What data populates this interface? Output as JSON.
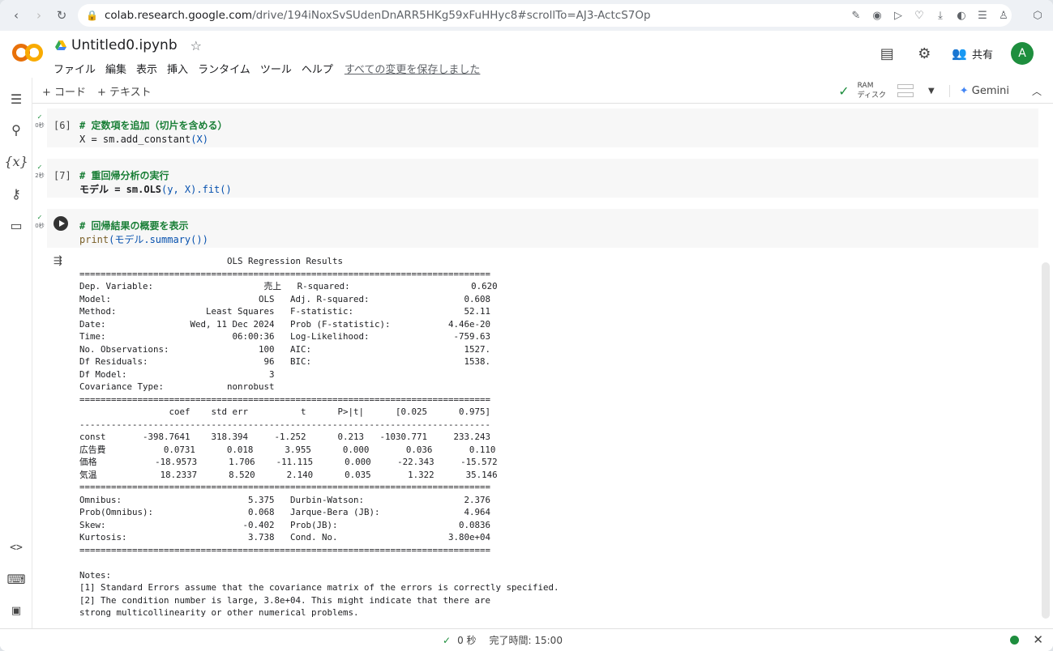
{
  "browser": {
    "url_host": "colab.research.google.com",
    "url_path": "/drive/194iNoxSvSUdenDnARR5HKg59xFuHHyc8#scrollTo=AJ3-ActcS7Op"
  },
  "header": {
    "filename": "Untitled0.ipynb",
    "menu": [
      "ファイル",
      "編集",
      "表示",
      "挿入",
      "ランタイム",
      "ツール",
      "ヘルプ"
    ],
    "saved_status": "すべての変更を保存しました",
    "share_label": "共有",
    "avatar_initial": "A"
  },
  "toolbar": {
    "add_code": "+ コード",
    "add_text": "+ テキスト",
    "ram_label": "RAM",
    "disk_label": "ディスク",
    "gemini_label": "Gemini"
  },
  "cells": [
    {
      "exec_count": "[6]",
      "status_check": "✓",
      "exec_time": "0秒",
      "comment": "# 定数項を追加（切片を含める）",
      "code_pre": "X = sm.add_constant",
      "code_args": "(X)"
    },
    {
      "exec_count": "[7]",
      "status_check": "✓",
      "exec_time": "2秒",
      "comment": "# 重回帰分析の実行",
      "code_pre": "モデル = sm.OLS",
      "code_args": "(y, X).fit()"
    },
    {
      "exec_count": "",
      "status_check": "✓",
      "exec_time": "0秒",
      "comment": "# 回帰結果の概要を表示",
      "code_pre": "print",
      "code_args": "(モデル.summary())"
    }
  ],
  "output_text": "                            OLS Regression Results                            \n==============================================================================\nDep. Variable:                     売上   R-squared:                       0.620\nModel:                            OLS   Adj. R-squared:                  0.608\nMethod:                 Least Squares   F-statistic:                     52.11\nDate:                Wed, 11 Dec 2024   Prob (F-statistic):           4.46e-20\nTime:                        06:00:36   Log-Likelihood:                -759.63\nNo. Observations:                 100   AIC:                             1527.\nDf Residuals:                      96   BIC:                             1538.\nDf Model:                           3                                         \nCovariance Type:            nonrobust                                         \n==============================================================================\n                 coef    std err          t      P>|t|      [0.025      0.975]\n------------------------------------------------------------------------------\nconst       -398.7641    318.394     -1.252      0.213   -1030.771     233.243\n広告費           0.0731      0.018      3.955      0.000       0.036       0.110\n価格           -18.9573      1.706    -11.115      0.000     -22.343     -15.572\n気温            18.2337      8.520      2.140      0.035       1.322      35.146\n==============================================================================\nOmnibus:                        5.375   Durbin-Watson:                   2.376\nProb(Omnibus):                  0.068   Jarque-Bera (JB):                4.964\nSkew:                          -0.402   Prob(JB):                       0.0836\nKurtosis:                       3.738   Cond. No.                     3.80e+04\n==============================================================================\n\nNotes:\n[1] Standard Errors assume that the covariance matrix of the errors is correctly specified.\n[2] The condition number is large, 3.8e+04. This might indicate that there are\nstrong multicollinearity or other numerical problems.",
  "statusbar": {
    "check": "✓",
    "time": "0 秒",
    "completed": "完了時間: 15:00"
  },
  "colors": {
    "accent_green": "#1e8e3e",
    "logo_orange": "#f9ab00",
    "logo_dark_orange": "#e8710a"
  }
}
